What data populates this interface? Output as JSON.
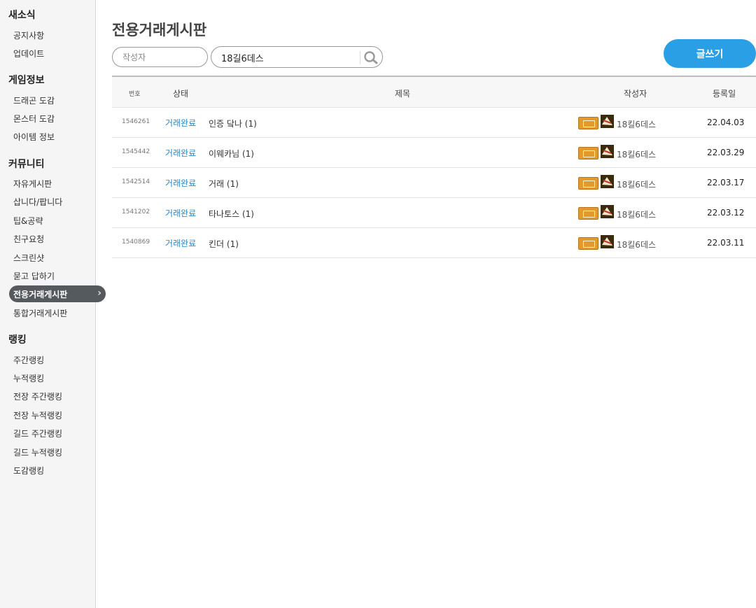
{
  "sidebar": {
    "groups": [
      {
        "title": "새소식",
        "items": [
          "공지사항",
          "업데이트"
        ]
      },
      {
        "title": "게임정보",
        "items": [
          "드래곤 도감",
          "몬스터 도감",
          "아이템 정보"
        ]
      },
      {
        "title": "커뮤니티",
        "items": [
          "자유게시판",
          "삽니다/팝니다",
          "팁&공략",
          "친구요청",
          "스크린샷",
          "묻고 답하기",
          "전용거래게시판",
          "통합거래게시판"
        ]
      },
      {
        "title": "랭킹",
        "items": [
          "주간랭킹",
          "누적랭킹",
          "전장 주간랭킹",
          "전장 누적랭킹",
          "길드 주간랭킹",
          "길드 누적랭킹",
          "도감랭킹"
        ]
      }
    ],
    "active_item": "전용거래게시판"
  },
  "main": {
    "page_title": "전용거래게시판",
    "search": {
      "author_filter": "작성자",
      "query": "18길6데스"
    },
    "write_button": "글쓰기",
    "table": {
      "headers": {
        "num": "번호",
        "status": "상태",
        "title": "제목",
        "author": "작성자",
        "date": "등록일"
      },
      "rows": [
        {
          "num": "1546261",
          "status": "거래완료",
          "title": "인증 닼나 (1)",
          "author": "18킬6데스",
          "date": "22.04.03"
        },
        {
          "num": "1545442",
          "status": "거래완료",
          "title": "이웨카님 (1)",
          "author": "18킬6데스",
          "date": "22.03.29"
        },
        {
          "num": "1542514",
          "status": "거래완료",
          "title": "거래 (1)",
          "author": "18킬6데스",
          "date": "22.03.17"
        },
        {
          "num": "1541202",
          "status": "거래완료",
          "title": "타나토스 (1)",
          "author": "18킬6데스",
          "date": "22.03.12"
        },
        {
          "num": "1540869",
          "status": "거래완료",
          "title": "킨더 (1)",
          "author": "18킬6데스",
          "date": "22.03.11"
        }
      ]
    }
  },
  "colors": {
    "accent": "#2b9fe5",
    "status_link": "#2b86c7",
    "active_nav": "#555a5f",
    "level_badge": "#e39a2c"
  }
}
